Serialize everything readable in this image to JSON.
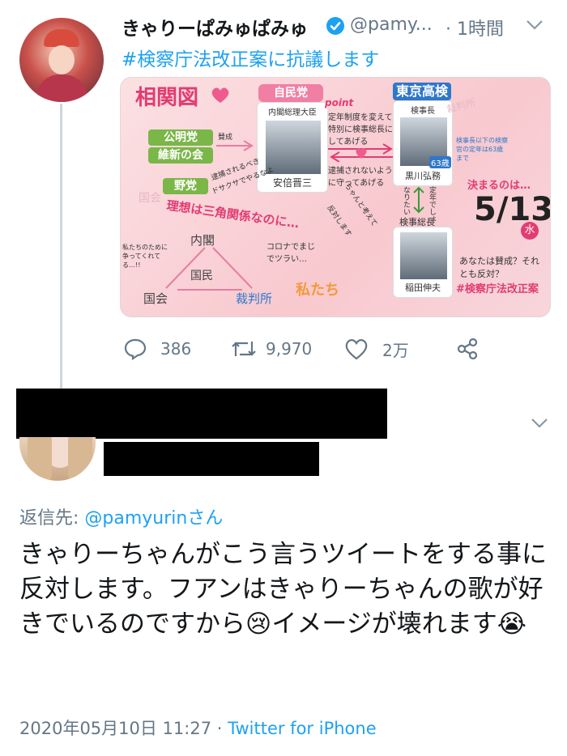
{
  "tweet": {
    "display_name": "きゃりーぱみゅぱみゅ",
    "handle": "@pamy...",
    "time": "· 1時間",
    "hashtag": "#検察庁法改正案に抗議します",
    "stats": {
      "replies": "386",
      "retweets": "9,970",
      "likes": "2万"
    }
  },
  "infographic": {
    "title": "相関図",
    "jimin": "自民党",
    "pm_title": "内閣総理大臣",
    "pm_name": "安倍晋三",
    "point": "point",
    "note1": "定年制度を変えて特別に検事総長にしてあげる",
    "note2": "逮捕されないように守ってあげる",
    "tokyo": "東京高検",
    "kenjicho": "検事長",
    "age": "63歳",
    "kurokawa": "黒川弘務",
    "naritai": "なりたい",
    "teinen": "定年でしょ",
    "sochou": "検事総長",
    "inada": "稲田伸夫",
    "komei": "公明党",
    "ishin": "維新の会",
    "yato": "野党",
    "kokkai_faint": "国会",
    "saibansho_faint": "裁判所",
    "bailiff": "賛成",
    "dogsa": "ドサクサでやるなよ",
    "taiho": "逮捕されるべき",
    "riso": "理想は三角関係なのに…",
    "naikaku": "内閣",
    "kokumin": "国民",
    "kokkai": "国会",
    "saibansho": "裁判所",
    "corona": "コロナでまじでツラい…",
    "watashitachi": "私たち",
    "ketsu": "決まるのは…",
    "date": "5/13",
    "dow": "水",
    "age_limit": "検事長以下の検察官の定年は63歳まで",
    "question": "あなたは賛成？それとも反対？",
    "tag": "#検察庁法改正案",
    "nakuni": "ちゃんと考えて",
    "hanshin": "反対します",
    "small_left": "私たちのために争ってくれてる…!!"
  },
  "reply": {
    "reply_to_prefix": "返信先: ",
    "reply_to_user": "@pamyurin",
    "reply_to_suffix": "さん",
    "body": "きゃりーちゃんがこう言うツイートをする事に反対します。フアンはきゃりーちゃんの歌が好きでいるのですから😢イメージが壊れます😭",
    "timestamp": "2020年05月10日 11:27",
    "separator": " · ",
    "source": "Twitter for iPhone"
  },
  "colors": {
    "link": "#1da1f2",
    "muted": "#657786",
    "verified": "#1da1f2"
  }
}
